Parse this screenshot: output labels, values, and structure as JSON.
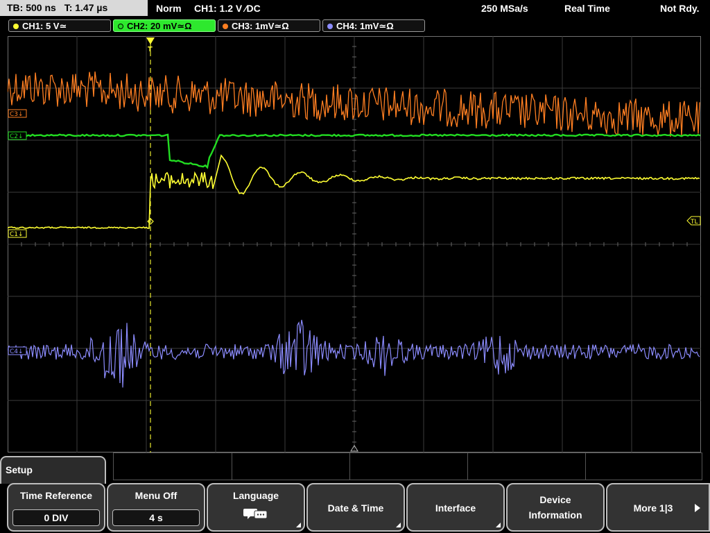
{
  "status": {
    "timebase": "TB: 500 ns",
    "trigger_time": "T: 1.47 µs",
    "mode": "Norm",
    "trigger": "CH1: 1.2 V ∕DC",
    "sample_rate": "250 MSa/s",
    "acq_mode": "Real Time",
    "state": "Not Rdy."
  },
  "channels": [
    {
      "label": "CH1: 5 V≃",
      "color": "#ffff33",
      "active": false
    },
    {
      "label": "CH2: 20 mV≃Ω",
      "color": "#22dd22",
      "active": true
    },
    {
      "label": "CH3: 1mV≃Ω",
      "color": "#ff7f22",
      "active": false
    },
    {
      "label": "CH4: 1mV≃Ω",
      "color": "#8c8cff",
      "active": false
    }
  ],
  "markers": {
    "c1": "C1↓",
    "c2": "C2↓",
    "c3": "C3↓",
    "c4": "C4↓",
    "trigger_level": "TL",
    "trigger_pos": "T"
  },
  "menu": {
    "title": "Setup",
    "softkeys": [
      {
        "label": "Time Reference",
        "value": "0 DIV"
      },
      {
        "label": "Menu Off",
        "value": "4 s"
      },
      {
        "label": "Language",
        "icon": "speech-bubble-icon"
      },
      {
        "label": "Date & Time"
      },
      {
        "label": "Interface"
      },
      {
        "label": "Device",
        "label2": "Information"
      },
      {
        "label": "More 1|3",
        "icon": "arrow-right-icon"
      }
    ]
  }
}
